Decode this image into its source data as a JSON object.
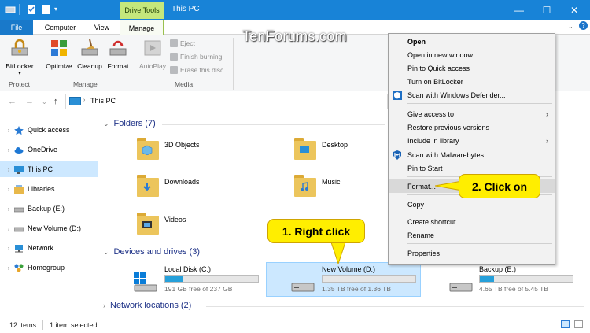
{
  "window": {
    "contextual_tab_label": "Drive Tools",
    "title": "This PC",
    "minimize": "—",
    "maximize": "☐",
    "close": "✕"
  },
  "tabs": [
    "File",
    "Computer",
    "View",
    "Manage"
  ],
  "ribbon": {
    "protect": {
      "bitlocker": "BitLocker",
      "group": "Protect"
    },
    "manage": {
      "optimize": "Optimize",
      "cleanup": "Cleanup",
      "format": "Format",
      "group": "Manage"
    },
    "media": {
      "autoplay": "AutoPlay",
      "eject": "Eject",
      "finish_burning": "Finish burning",
      "erase": "Erase this disc",
      "group": "Media"
    }
  },
  "address": {
    "path": "This PC"
  },
  "nav": {
    "items": [
      "Quick access",
      "OneDrive",
      "This PC",
      "Libraries",
      "Backup (E:)",
      "New Volume (D:)",
      "Network",
      "Homegroup"
    ]
  },
  "content": {
    "folders_header": "Folders (7)",
    "folders": [
      "3D Objects",
      "Desktop",
      "Downloads",
      "Music",
      "Videos"
    ],
    "devices_header": "Devices and drives (3)",
    "drives": [
      {
        "name": "Local Disk (C:)",
        "free": "191 GB free of 237 GB",
        "used_fraction": 0.19
      },
      {
        "name": "New Volume (D:)",
        "free": "1.35 TB free of 1.36 TB",
        "used_fraction": 0.01
      },
      {
        "name": "Backup (E:)",
        "free": "4.65 TB free of 5.45 TB",
        "used_fraction": 0.15
      }
    ],
    "network_header": "Network locations (2)"
  },
  "status": {
    "items": "12 items",
    "selected": "1 item selected"
  },
  "context_menu": {
    "items": [
      "Open",
      "Open in new window",
      "Pin to Quick access",
      "Turn on BitLocker",
      "Scan with Windows Defender...",
      "Give access to",
      "Restore previous versions",
      "Include in library",
      "Scan with Malwarebytes",
      "Pin to Start",
      "Format...",
      "Copy",
      "Create shortcut",
      "Rename",
      "Properties"
    ]
  },
  "callouts": {
    "right_click": "1. Right click",
    "click_on": "2. Click on"
  },
  "watermark": "TenForums.com"
}
